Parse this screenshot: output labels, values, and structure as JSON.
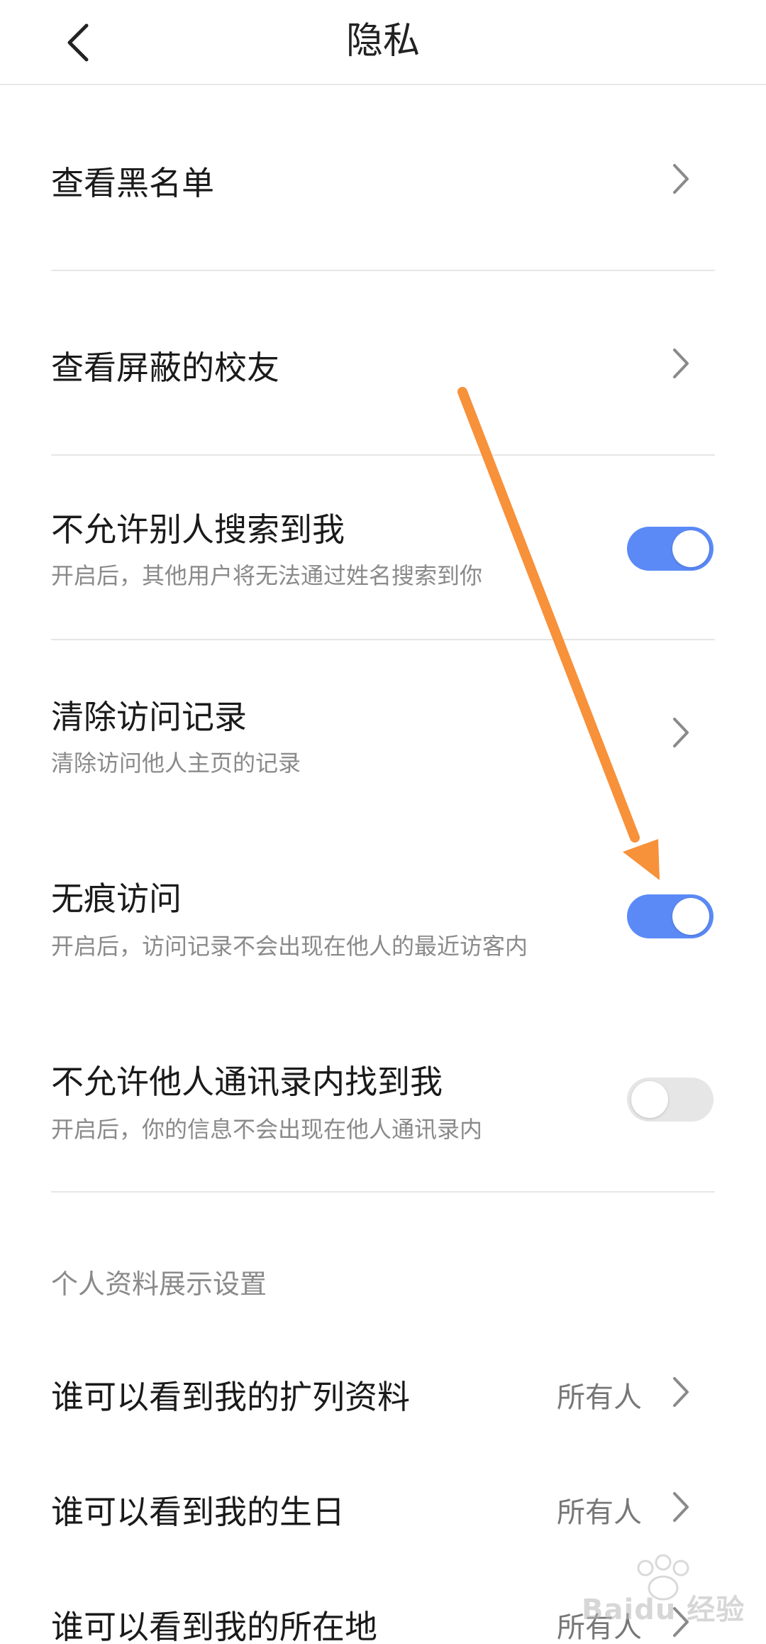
{
  "header": {
    "title": "隐私",
    "back_icon": "chevron-left-icon"
  },
  "rows": {
    "blacklist": {
      "title": "查看黑名单"
    },
    "blocked": {
      "title": "查看屏蔽的校友"
    },
    "search": {
      "title": "不允许别人搜索到我",
      "subtitle": "开启后，其他用户将无法通过姓名搜索到你",
      "enabled": true
    },
    "clear_history": {
      "title": "清除访问记录",
      "subtitle": "清除访问他人主页的记录"
    },
    "incognito": {
      "title": "无痕访问",
      "subtitle": "开启后，访问记录不会出现在他人的最近访客内",
      "enabled": true
    },
    "contacts": {
      "title": "不允许他人通讯录内找到我",
      "subtitle": "开启后，你的信息不会出现在他人通讯录内",
      "enabled": false
    }
  },
  "profile_section": {
    "title": "个人资料展示设置",
    "items": [
      {
        "title": "谁可以看到我的扩列资料",
        "value": "所有人"
      },
      {
        "title": "谁可以看到我的生日",
        "value": "所有人"
      },
      {
        "title": "谁可以看到我的所在地",
        "value": "所有人"
      }
    ]
  },
  "colors": {
    "toggle_on": "#5b8af7",
    "toggle_off": "#e6e6e6",
    "annotation_arrow": "#f7913a"
  },
  "watermark": {
    "text": "Baidu 经验"
  }
}
